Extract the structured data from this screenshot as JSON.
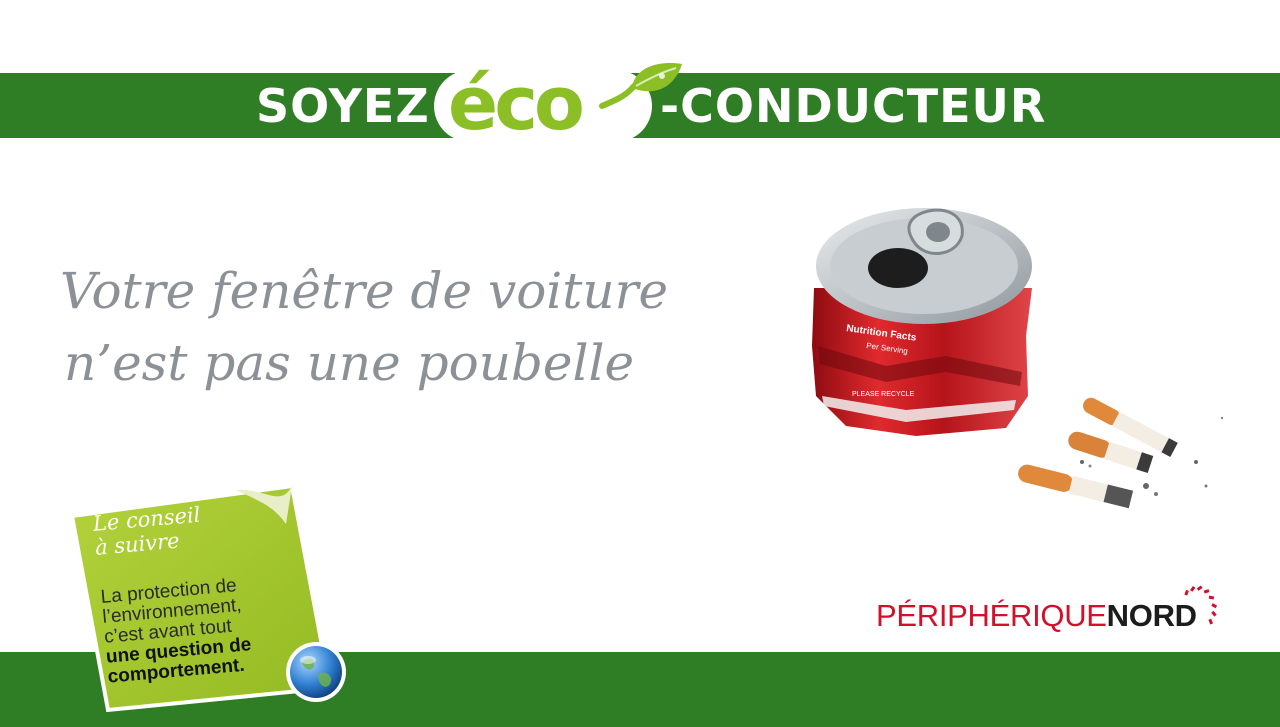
{
  "headline": {
    "prefix": "SOYEZ",
    "eco": "éco",
    "suffix": "-CONDUCTEUR"
  },
  "slogan": {
    "line1": "Votre fenêtre de voiture",
    "line2": "n’est pas une poubelle"
  },
  "tip": {
    "title_line1": "Le conseil",
    "title_line2": "à suivre",
    "body_line1": "La protection de",
    "body_line2": "l’environnement,",
    "body_line3": "c’est avant tout",
    "body_line4": "une question de",
    "body_line5": "comportement."
  },
  "brand": {
    "part1": "PÉRIPHÉRIQUE",
    "part2": "NORD"
  },
  "can_label": {
    "line1": "Nutrition Facts",
    "line2": "Per Serving",
    "line3": "PLEASE RECYCLE"
  },
  "colors": {
    "band_green": "#2f7d24",
    "eco_green": "#8cbe26",
    "slogan_grey": "#8b9196",
    "brand_red": "#d3102a",
    "sticker_green": "#9fc42a"
  },
  "icons": {
    "leaf": "leaf-icon",
    "globe": "globe-icon",
    "brand_arc": "arc-dots-icon"
  }
}
